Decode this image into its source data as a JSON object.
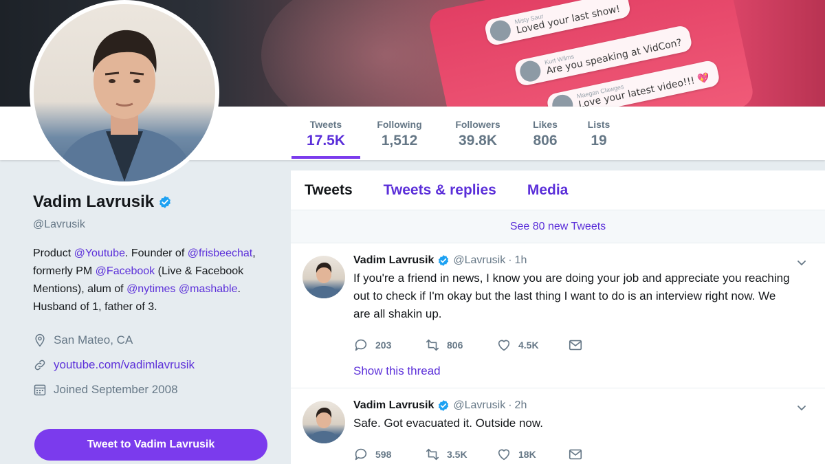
{
  "banner": {
    "bubbles": [
      {
        "name": "Misty Saur",
        "message": "Loved your last show!"
      },
      {
        "name": "Kurt Wilms",
        "message": "Are you speaking at VidCon?"
      },
      {
        "name": "Maegan Clawges",
        "message": "Love your latest video!!! 💖"
      }
    ]
  },
  "stats": [
    {
      "label": "Tweets",
      "value": "17.5K"
    },
    {
      "label": "Following",
      "value": "1,512"
    },
    {
      "label": "Followers",
      "value": "39.8K"
    },
    {
      "label": "Likes",
      "value": "806"
    },
    {
      "label": "Lists",
      "value": "19"
    }
  ],
  "profile": {
    "name": "Vadim Lavrusik",
    "handle": "@Lavrusik",
    "bio": {
      "t1": "Product ",
      "m1": "@Youtube",
      "t2": ". Founder of ",
      "m2": "@frisbeechat",
      "t3": ", formerly PM ",
      "m3": "@Facebook",
      "t4": " (Live & Facebook Mentions), alum of ",
      "m4": "@nytimes",
      "t5": " ",
      "m5": "@mashable",
      "t6": ". Husband of 1, father of 3."
    },
    "location": "San Mateo, CA",
    "website": "youtube.com/vadimlavrusik",
    "joined": "Joined September 2008",
    "tweet_to_label": "Tweet to Vadim Lavrusik"
  },
  "timeline": {
    "tabs": [
      "Tweets",
      "Tweets & replies",
      "Media"
    ],
    "new_tweets": "See 80 new Tweets",
    "tweets": [
      {
        "name": "Vadim Lavrusik",
        "handle": "@Lavrusik",
        "dot": "·",
        "time": "1h",
        "text": "If you're a friend in news, I know you are doing your job and appreciate you reaching out to check if I'm okay but the last thing I want to do is an interview right now. We are all shakin up.",
        "replies": "203",
        "retweets": "806",
        "likes": "4.5K",
        "thread": "Show this thread"
      },
      {
        "name": "Vadim Lavrusik",
        "handle": "@Lavrusik",
        "dot": "·",
        "time": "2h",
        "text": "Safe. Got evacuated it. Outside now.",
        "replies": "598",
        "retweets": "3.5K",
        "likes": "18K"
      }
    ]
  },
  "colors": {
    "accent": "#7b3bed",
    "link": "#5b2fd9",
    "verified": "#1da1f2",
    "muted": "#657786"
  }
}
